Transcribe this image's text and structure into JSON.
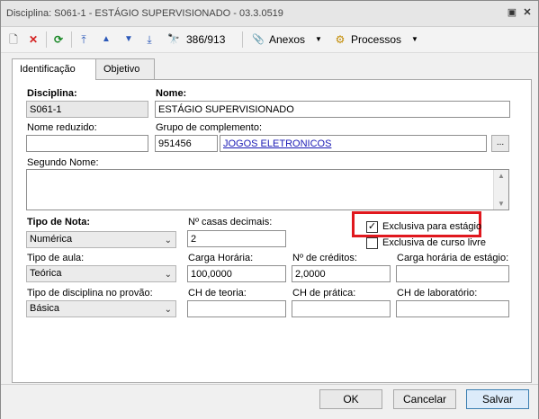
{
  "window": {
    "title": "Disciplina: S061-1 - ESTÁGIO SUPERVISIONADO - 03.3.0519",
    "restore_glyph": "▣",
    "close_glyph": "✕"
  },
  "toolbar": {
    "new_glyph": "🗋",
    "delete_glyph": "✕",
    "refresh_glyph": "⟳",
    "first_glyph": "⤒",
    "prev_glyph": "▲",
    "next_glyph": "▼",
    "last_glyph": "⤓",
    "binoculars_glyph": "🔭",
    "record_counter": "386/913",
    "attach_glyph": "📎",
    "anexos_label": "Anexos",
    "processos_glyph": "⚙",
    "processos_label": "Processos",
    "dropdown_glyph": "▼"
  },
  "tabs": [
    "Identificação",
    "Objetivo"
  ],
  "form": {
    "disciplina_label": "Disciplina:",
    "disciplina_value": "S061-1",
    "nome_label": "Nome:",
    "nome_value": "ESTÁGIO SUPERVISIONADO",
    "nome_reduzido_label": "Nome reduzido:",
    "nome_reduzido_value": "",
    "grupo_label": "Grupo de complemento:",
    "grupo_code": "951456",
    "grupo_name": "JOGOS ELETRONICOS",
    "grupo_browse": "...",
    "segundo_nome_label": "Segundo Nome:",
    "segundo_nome_value": "",
    "tipo_nota_label": "Tipo de Nota:",
    "tipo_nota_value": "Numérica",
    "casas_decimais_label": "Nº casas decimais:",
    "casas_decimais_value": "2",
    "exclusiva_estagio_label": "Exclusiva para estágio",
    "exclusiva_estagio_checked": true,
    "exclusiva_curso_livre_label": "Exclusiva de curso livre",
    "exclusiva_curso_livre_checked": false,
    "tipo_aula_label": "Tipo de aula:",
    "tipo_aula_value": "Teórica",
    "carga_horaria_label": "Carga Horária:",
    "carga_horaria_value": "100,0000",
    "creditos_label": "Nº de créditos:",
    "creditos_value": "2,0000",
    "carga_estagio_label": "Carga horária de estágio:",
    "carga_estagio_value": "",
    "tipo_provao_label": "Tipo de disciplina no provão:",
    "tipo_provao_value": "Básica",
    "ch_teoria_label": "CH de teoria:",
    "ch_teoria_value": "",
    "ch_pratica_label": "CH de prática:",
    "ch_pratica_value": "",
    "ch_laboratorio_label": "CH de laboratório:",
    "ch_laboratorio_value": "",
    "check_glyph": "✓",
    "select_arrow": "⌄",
    "scroll_up": "▲",
    "scroll_down": "▼"
  },
  "buttons": {
    "ok": "OK",
    "cancelar": "Cancelar",
    "salvar": "Salvar"
  },
  "colors": {
    "highlight": "#e0181e",
    "link": "#1a1ab5",
    "primary_border": "#3c7fb1"
  }
}
